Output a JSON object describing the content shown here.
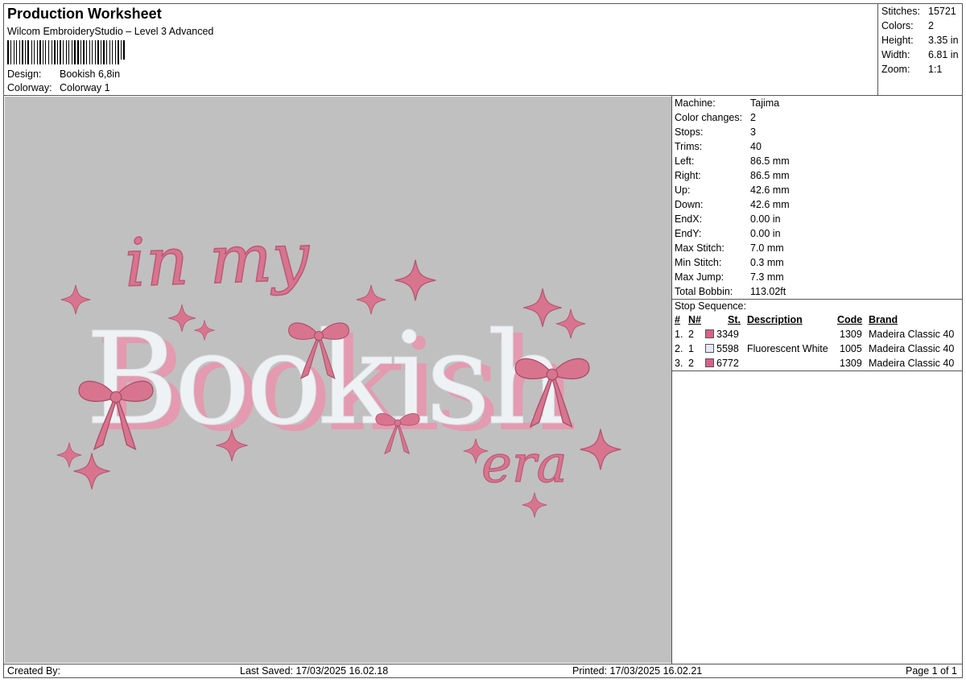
{
  "header": {
    "title": "Production Worksheet",
    "subtitle": "Wilcom EmbroideryStudio – Level 3 Advanced",
    "design_label": "Design:",
    "design_value": "Bookish 6,8in",
    "colorway_label": "Colorway:",
    "colorway_value": "Colorway 1"
  },
  "summary": [
    {
      "label": "Stitches:",
      "value": "15721"
    },
    {
      "label": "Colors:",
      "value": "2"
    },
    {
      "label": "Height:",
      "value": "3.35 in"
    },
    {
      "label": "Width:",
      "value": "6.81 in"
    },
    {
      "label": "Zoom:",
      "value": "1:1"
    }
  ],
  "design_preview": {
    "line1": "in my",
    "line2": "Bookish",
    "line3": "era",
    "colors": {
      "pink": "#d9748f",
      "white": "#eef2f4",
      "background": "#c0c0c0"
    }
  },
  "machine_info": [
    {
      "label": "Machine:",
      "value": "Tajima"
    },
    {
      "label": "Color changes:",
      "value": "2"
    },
    {
      "label": "Stops:",
      "value": "3"
    },
    {
      "label": "Trims:",
      "value": "40"
    },
    {
      "label": "Left:",
      "value": "86.5 mm"
    },
    {
      "label": "Right:",
      "value": "86.5 mm"
    },
    {
      "label": "Up:",
      "value": "42.6 mm"
    },
    {
      "label": "Down:",
      "value": "42.6 mm"
    },
    {
      "label": "EndX:",
      "value": "0.00 in"
    },
    {
      "label": "EndY:",
      "value": "0.00 in"
    },
    {
      "label": "Max Stitch:",
      "value": "7.0 mm"
    },
    {
      "label": "Min Stitch:",
      "value": "0.3 mm"
    },
    {
      "label": "Max Jump:",
      "value": "7.3 mm"
    },
    {
      "label": "Total Bobbin:",
      "value": "113.02ft"
    }
  ],
  "stop_sequence": {
    "title": "Stop Sequence:",
    "headers": {
      "num": "#",
      "n": "N#",
      "st": "St.",
      "description": "Description",
      "code": "Code",
      "brand": "Brand"
    },
    "rows": [
      {
        "num": "1.",
        "n": "2",
        "color": "#d9608a",
        "st": "3349",
        "description": "",
        "code": "1309",
        "brand": "Madeira Classic 40"
      },
      {
        "num": "2.",
        "n": "1",
        "color": "#e6e8f8",
        "st": "5598",
        "description": "Fluorescent White",
        "code": "1005",
        "brand": "Madeira Classic 40"
      },
      {
        "num": "3.",
        "n": "2",
        "color": "#d9608a",
        "st": "6772",
        "description": "",
        "code": "1309",
        "brand": "Madeira Classic 40"
      }
    ]
  },
  "footer": {
    "created_by": "Created By:",
    "last_saved": "Last Saved: 17/03/2025 16.02.18",
    "printed": "Printed: 17/03/2025 16.02.21",
    "page": "Page 1 of 1"
  }
}
